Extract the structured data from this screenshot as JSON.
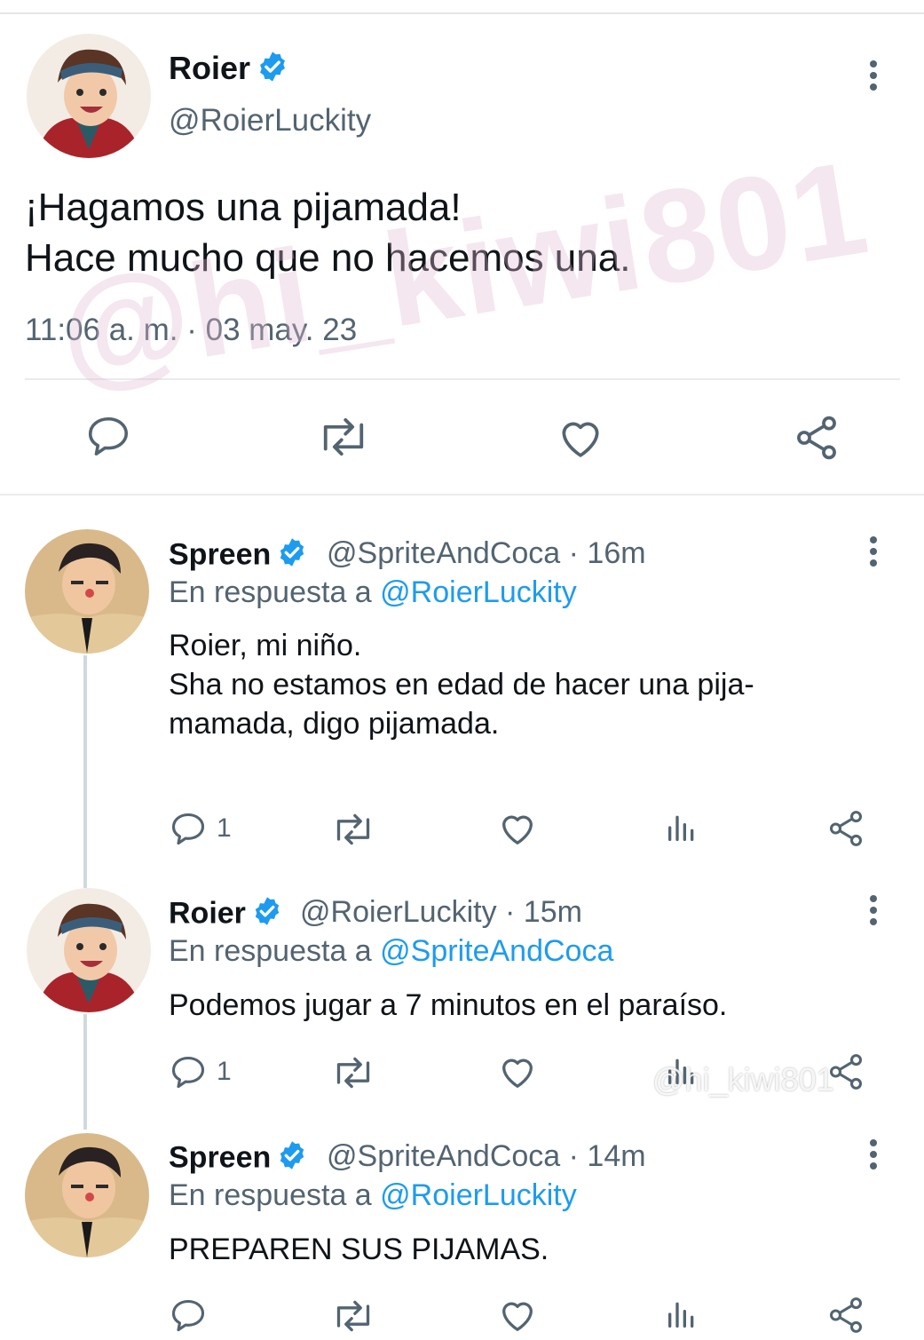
{
  "main_tweet": {
    "name": "Roier",
    "handle": "@RoierLuckity",
    "text_line1": "¡Hagamos una pijamada!",
    "text_line2": "Hace mucho que no hacemos una.",
    "timestamp": "11:06 a. m. · 03 may. 23"
  },
  "replies": [
    {
      "name": "Spreen",
      "handle_time": "@SpriteAndCoca · 16m",
      "reply_prefix": "En respuesta a",
      "reply_to": "@RoierLuckity",
      "text_line1": "Roier, mi niño.",
      "text_line2": "Sha no estamos en edad de hacer una pija-",
      "text_line3": "mamada, digo pijamada.",
      "reply_count": "1"
    },
    {
      "name": "Roier",
      "handle_time": "@RoierLuckity · 15m",
      "reply_prefix": "En respuesta a",
      "reply_to": "@SpriteAndCoca",
      "text_line1": "Podemos jugar a 7 minutos en el paraíso.",
      "reply_count": "1"
    },
    {
      "name": "Spreen",
      "handle_time": "@SpriteAndCoca · 14m",
      "reply_prefix": "En respuesta a",
      "reply_to": "@RoierLuckity",
      "text_line1": "PREPAREN SUS PIJAMAS."
    }
  ],
  "watermarks": {
    "main": "@hi_kiwi801",
    "tiktok": "@hi_kiwi801"
  },
  "colors": {
    "accent": "#1d9bf0",
    "secondary_text": "#536471",
    "verified": "#1d9bf0"
  },
  "icons": [
    "reply-icon",
    "retweet-icon",
    "like-icon",
    "share-icon",
    "analytics-icon",
    "more-icon",
    "verified-icon"
  ]
}
